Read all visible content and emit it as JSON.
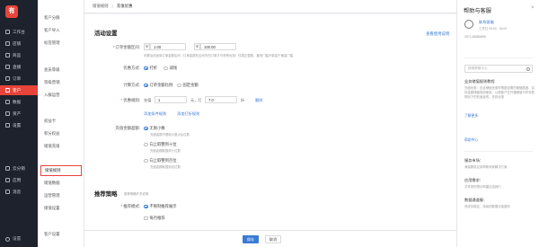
{
  "nav": {
    "logo": "有",
    "items": [
      {
        "label": "工作台"
      },
      {
        "label": "店铺"
      },
      {
        "label": "商品"
      },
      {
        "label": "直播"
      },
      {
        "label": "订单"
      },
      {
        "label": "客户"
      },
      {
        "label": "数据"
      },
      {
        "label": "资产"
      },
      {
        "label": "设置"
      },
      {
        "label": "云分销"
      },
      {
        "label": "应用"
      },
      {
        "label": "消息"
      }
    ],
    "footer": "设置"
  },
  "submenu": {
    "items": [
      "客户分群",
      "客户导入",
      "标签管理",
      "会员等级",
      "等级营销",
      "入群运营",
      "权益卡",
      "积分权益",
      "储值充值",
      "储值规则",
      "储值数据",
      "运营管理",
      "储值设置",
      "客户设置"
    ]
  },
  "breadcrumb": {
    "parent": "储值规则",
    "sep": "/",
    "current": "充值优惠"
  },
  "activity": {
    "title": "活动设置",
    "help_link": "查看使用说明",
    "amount_label": "订单金额区间:",
    "amount_prefix": "¥",
    "amount_min": "1.00",
    "amount_max": "100.00",
    "amount_hint": "设置活动适用订单金额区间（订单金额在区间内的订单才可享受优惠）仅限正整数，最低门槛不能高于最高门槛",
    "discount_type_label": "优惠方式:",
    "discount_type_options": [
      "打折",
      "减钱"
    ],
    "calc_label": "计算方式:",
    "calc_options": [
      "订单金额比例",
      "固定金额"
    ],
    "rule_label": "优惠规则:",
    "rule_prefix": "充值",
    "rule_amount": "1",
    "rule_mid": "元，打",
    "rule_discount": "7.0",
    "rule_unit": "折",
    "rule_delete": "删除",
    "add_rule": "添加条件规则",
    "add_other": "添加打折规则",
    "overflow_label": "充值金额超额:",
    "overflow_options": [
      {
        "label": "无限小数",
        "hint": "充值金额不限制小数点后位数"
      },
      {
        "label": "向上取整到十位",
        "hint": "充值金额取整到十位数"
      },
      {
        "label": "向上取整到百位",
        "hint": "充值金额取整到百位数"
      }
    ]
  },
  "recommend": {
    "title": "推荐策略",
    "title_hint": "推荐策略开关说明",
    "mode_label": "推荐模式:",
    "options": [
      "不限制推荐展示",
      "每月推荐"
    ]
  },
  "actions": {
    "save": "保存",
    "cancel": "取消"
  },
  "help_panel": {
    "title": "帮助与客服",
    "close": "×",
    "cs_name": "联系客服",
    "cs_time": "工作日 09:00 - 18:00",
    "cs_phone": "0571-88888888",
    "search_placeholder": "搜索帮助中心",
    "guide_title": "业务储值规则教程",
    "guide_body": "充值优惠：包含储值优惠时根据设置的储值额度、实际金额储值规则使用，以便客户在开通储值卡时享受规则下的充值返现、折扣优惠",
    "guide_more": "了解更多",
    "center_link": "帮助中心",
    "service_title": "服务市场：",
    "service_body": "海量服务应用帮助商家解决方案",
    "app_title": "应用需求：",
    "app_body": "共享您的想法和建议给我们",
    "feedback_title": "数据通道服：",
    "feedback_body": "低成本稳定、持续的数据对接服务"
  }
}
